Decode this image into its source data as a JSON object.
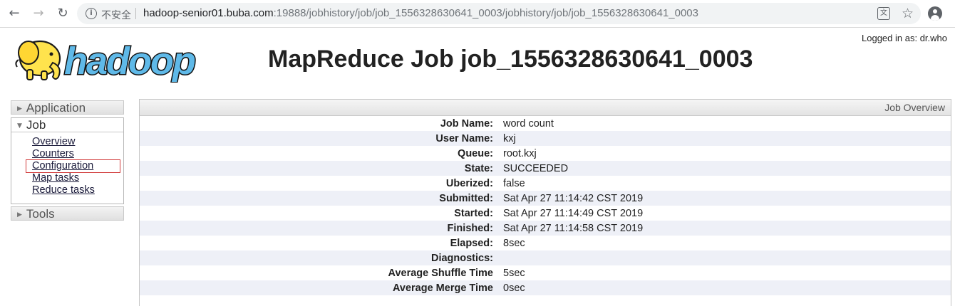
{
  "browser": {
    "insecure_label": "不安全",
    "url_host": "hadoop-senior01.buba.com",
    "url_path": ":19888/jobhistory/job/job_1556328630641_0003/jobhistory/job/job_1556328630641_0003"
  },
  "header": {
    "logged_in": "Logged in as: dr.who",
    "title": "MapReduce Job job_1556328630641_0003",
    "logo_text": "hadoop"
  },
  "sidebar": {
    "application_label": "Application",
    "job_label": "Job",
    "tools_label": "Tools",
    "job_links": [
      "Overview",
      "Counters",
      "Configuration",
      "Map tasks",
      "Reduce tasks"
    ]
  },
  "panel": {
    "title": "Job Overview",
    "rows": [
      {
        "label": "Job Name:",
        "value": "word count"
      },
      {
        "label": "User Name:",
        "value": "kxj"
      },
      {
        "label": "Queue:",
        "value": "root.kxj"
      },
      {
        "label": "State:",
        "value": "SUCCEEDED"
      },
      {
        "label": "Uberized:",
        "value": "false"
      },
      {
        "label": "Submitted:",
        "value": "Sat Apr 27 11:14:42 CST 2019"
      },
      {
        "label": "Started:",
        "value": "Sat Apr 27 11:14:49 CST 2019"
      },
      {
        "label": "Finished:",
        "value": "Sat Apr 27 11:14:58 CST 2019"
      },
      {
        "label": "Elapsed:",
        "value": "8sec"
      },
      {
        "label": "Diagnostics:",
        "value": ""
      },
      {
        "label": "Average Shuffle Time",
        "value": "5sec"
      },
      {
        "label": "Average Merge Time",
        "value": "0sec"
      }
    ]
  },
  "icons": {
    "back": "arrow-left-icon",
    "forward": "arrow-right-icon",
    "reload": "reload-icon",
    "info": "info-icon",
    "translate": "translate-icon",
    "bookmark": "star-icon",
    "account": "account-icon",
    "logo": "hadoop-elephant-logo"
  },
  "colors": {
    "logo_yellow": "#ffe34d",
    "logo_blue": "#5fb9e8",
    "highlight_box": "#d23c3c",
    "alt_row": "#eef0f7"
  }
}
